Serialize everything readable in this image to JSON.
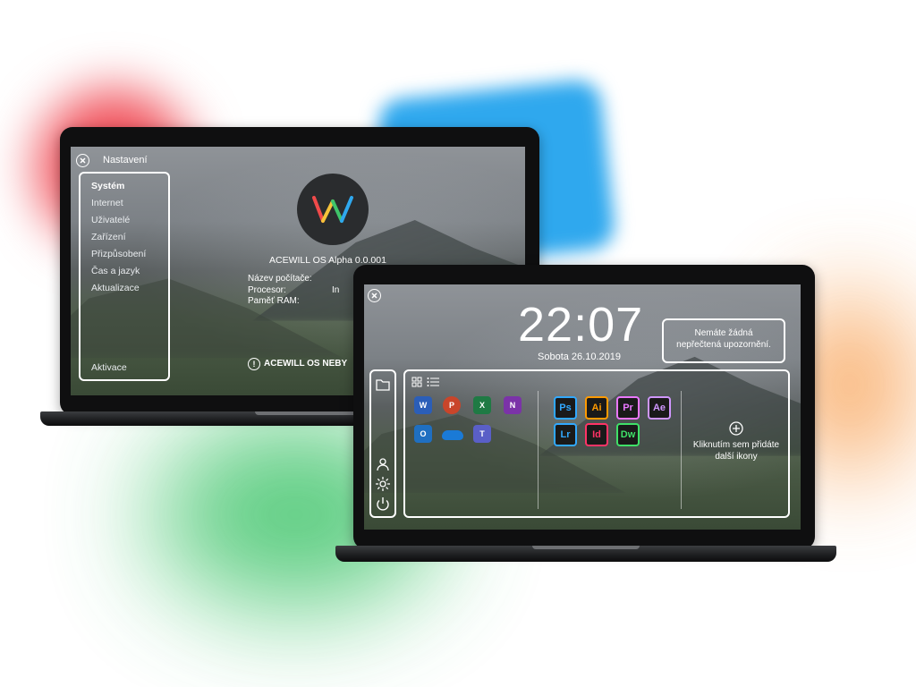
{
  "settings_window": {
    "title": "Nastavení",
    "menu": [
      "Systém",
      "Internet",
      "Uživatelé",
      "Zařízení",
      "Přizpůsobení",
      "Čas a jazyk",
      "Aktualizace"
    ],
    "activate_label": "Aktivace",
    "os_version": "ACEWILL OS Alpha 0.0.001",
    "info_labels": [
      "Název počítače:",
      "Procesor:",
      "Paměť RAM:"
    ],
    "processor_value_partial": "In",
    "warning_text": "ACEWILL OS NEBY"
  },
  "desktop": {
    "time": "22:07",
    "date": "Sobota 26.10.2019",
    "notification": "Nemáte žádná nepřečtená upozornění.",
    "add_icons_label": "Kliknutím sem přidáte další ikony",
    "office_apps": [
      {
        "label": "W",
        "icon": "word-icon",
        "color": "#2b5eb8"
      },
      {
        "label": "P",
        "icon": "powerpoint-icon",
        "color": "#c9452a"
      },
      {
        "label": "X",
        "icon": "excel-icon",
        "color": "#1f7a44"
      },
      {
        "label": "N",
        "icon": "onenote-icon",
        "color": "#7b33a8"
      },
      {
        "label": "O",
        "icon": "outlook-icon",
        "color": "#1f6fc1"
      },
      {
        "label": "",
        "icon": "onedrive-icon",
        "color": "#1a7ad6"
      },
      {
        "label": "T",
        "icon": "teams-icon",
        "color": "#5a5fc7"
      }
    ],
    "adobe_apps": [
      {
        "label": "Ps",
        "icon": "photoshop-icon",
        "color": "#31a8ff"
      },
      {
        "label": "Ai",
        "icon": "illustrator-icon",
        "color": "#ff9a00"
      },
      {
        "label": "Pr",
        "icon": "premiere-icon",
        "color": "#ea77ff"
      },
      {
        "label": "Ae",
        "icon": "after-effects-icon",
        "color": "#cf96fd"
      },
      {
        "label": "Lr",
        "icon": "lightroom-icon",
        "color": "#31a8ff"
      },
      {
        "label": "Id",
        "icon": "indesign-icon",
        "color": "#ff3366"
      },
      {
        "label": "Dw",
        "icon": "dreamweaver-icon",
        "color": "#3fe068"
      }
    ]
  }
}
